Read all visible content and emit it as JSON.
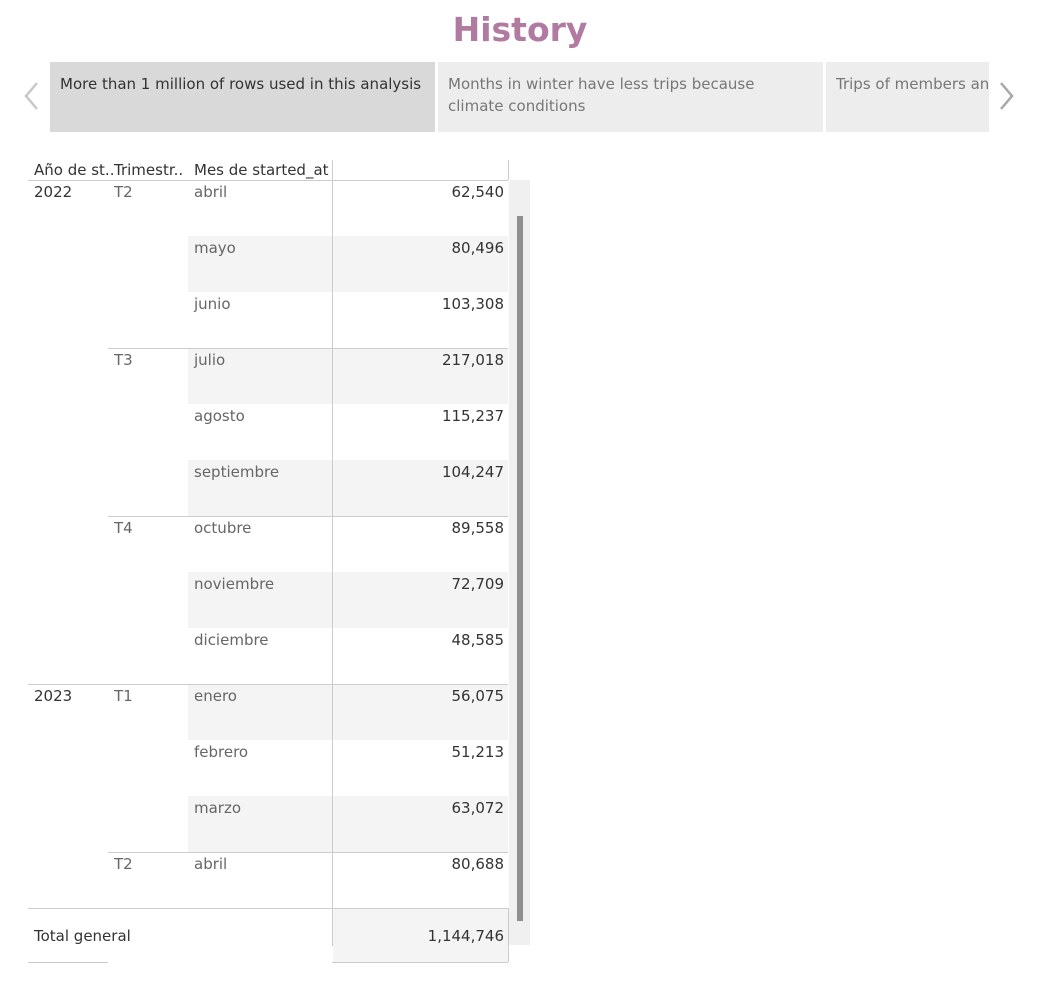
{
  "page": {
    "title": "History"
  },
  "storybook": {
    "points": [
      {
        "label": "More than 1 million of rows used in this analysis"
      },
      {
        "label": "Months in winter have less trips because climate conditions"
      },
      {
        "label": "Trips of members and time for less than one"
      }
    ]
  },
  "table": {
    "headers": {
      "year": "Año de st..",
      "quarter": "Trimestr..",
      "month": "Mes de started_at"
    },
    "rows": [
      {
        "year": "2022",
        "quarter": "T2",
        "month": "abril",
        "value": "62,540"
      },
      {
        "year": "",
        "quarter": "",
        "month": "mayo",
        "value": "80,496"
      },
      {
        "year": "",
        "quarter": "",
        "month": "junio",
        "value": "103,308"
      },
      {
        "year": "",
        "quarter": "T3",
        "month": "julio",
        "value": "217,018"
      },
      {
        "year": "",
        "quarter": "",
        "month": "agosto",
        "value": "115,237"
      },
      {
        "year": "",
        "quarter": "",
        "month": "septiembre",
        "value": "104,247"
      },
      {
        "year": "",
        "quarter": "T4",
        "month": "octubre",
        "value": "89,558"
      },
      {
        "year": "",
        "quarter": "",
        "month": "noviembre",
        "value": "72,709"
      },
      {
        "year": "",
        "quarter": "",
        "month": "diciembre",
        "value": "48,585"
      },
      {
        "year": "2023",
        "quarter": "T1",
        "month": "enero",
        "value": "56,075"
      },
      {
        "year": "",
        "quarter": "",
        "month": "febrero",
        "value": "51,213"
      },
      {
        "year": "",
        "quarter": "",
        "month": "marzo",
        "value": "63,072"
      },
      {
        "year": "",
        "quarter": "T2",
        "month": "abril",
        "value": "80,688"
      }
    ],
    "total": {
      "label": "Total general",
      "value": "1,144,746"
    }
  }
}
